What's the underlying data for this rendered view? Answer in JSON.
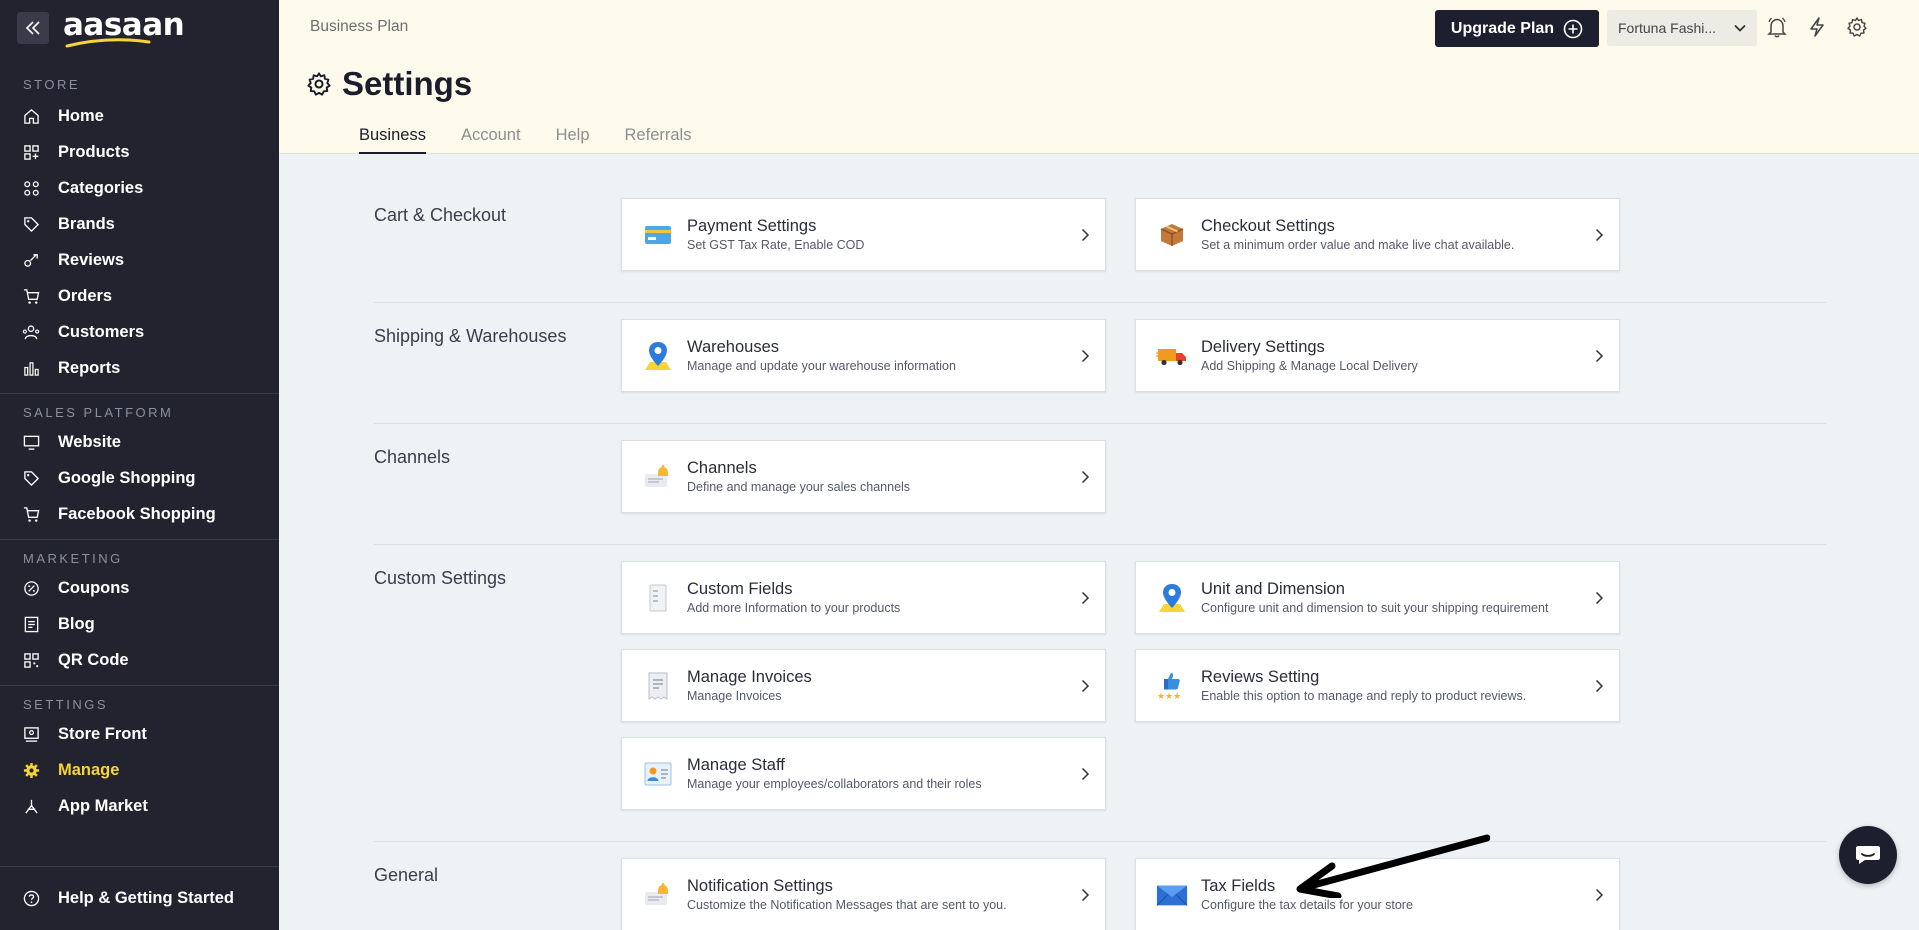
{
  "sidebar": {
    "brand": "aasaan",
    "sections": [
      {
        "label": "STORE",
        "items": [
          {
            "label": "Home",
            "icon": "home-icon"
          },
          {
            "label": "Products",
            "icon": "products-icon"
          },
          {
            "label": "Categories",
            "icon": "categories-icon"
          },
          {
            "label": "Brands",
            "icon": "tag-icon"
          },
          {
            "label": "Reviews",
            "icon": "reviews-icon"
          },
          {
            "label": "Orders",
            "icon": "cart-icon"
          },
          {
            "label": "Customers",
            "icon": "customers-icon"
          },
          {
            "label": "Reports",
            "icon": "reports-icon"
          }
        ]
      },
      {
        "label": "SALES PLATFORM",
        "items": [
          {
            "label": "Website",
            "icon": "monitor-icon"
          },
          {
            "label": "Google Shopping",
            "icon": "tag-icon"
          },
          {
            "label": "Facebook Shopping",
            "icon": "cart-icon"
          }
        ]
      },
      {
        "label": "MARKETING",
        "items": [
          {
            "label": "Coupons",
            "icon": "coupon-icon"
          },
          {
            "label": "Blog",
            "icon": "blog-icon"
          },
          {
            "label": "QR Code",
            "icon": "qr-icon"
          }
        ]
      },
      {
        "label": "SETTINGS",
        "items": [
          {
            "label": "Store Front",
            "icon": "storefront-icon"
          },
          {
            "label": "Manage",
            "icon": "gear-icon",
            "active": true
          },
          {
            "label": "App Market",
            "icon": "app-market-icon"
          }
        ]
      }
    ],
    "help": "Help & Getting Started",
    "active_color": "#f6d534",
    "bg_color": "#23232f"
  },
  "header": {
    "plan": "Business Plan",
    "upgrade": "Upgrade Plan",
    "store": "Fortuna Fashi...",
    "title": "Settings",
    "tabs": [
      "Business",
      "Account",
      "Help",
      "Referrals"
    ],
    "active_tab": "Business"
  },
  "sections": {
    "cart": "Cart & Checkout",
    "shipping": "Shipping & Warehouses",
    "channels": "Channels",
    "custom": "Custom Settings",
    "general": "General"
  },
  "cards": {
    "payment": {
      "title": "Payment Settings",
      "desc": "Set GST Tax Rate, Enable COD"
    },
    "checkout": {
      "title": "Checkout Settings",
      "desc": "Set a minimum order value and make live chat available."
    },
    "warehouses": {
      "title": "Warehouses",
      "desc": "Manage and update your warehouse information"
    },
    "delivery": {
      "title": "Delivery Settings",
      "desc": "Add Shipping & Manage Local Delivery"
    },
    "channels": {
      "title": "Channels",
      "desc": "Define and manage your sales channels"
    },
    "custom_fields": {
      "title": "Custom Fields",
      "desc": "Add more Information to your products"
    },
    "unit_dimension": {
      "title": "Unit and Dimension",
      "desc": "Configure unit and dimension to suit your shipping requirement"
    },
    "invoices": {
      "title": "Manage Invoices",
      "desc": "Manage Invoices"
    },
    "reviews_setting": {
      "title": "Reviews Setting",
      "desc": "Enable this option to manage and reply to product reviews."
    },
    "staff": {
      "title": "Manage Staff",
      "desc": "Manage your employees/collaborators and their roles"
    },
    "notifications": {
      "title": "Notification Settings",
      "desc": "Customize the Notification Messages that are sent to you."
    },
    "tax": {
      "title": "Tax Fields",
      "desc": "Configure the tax details for your store"
    }
  }
}
